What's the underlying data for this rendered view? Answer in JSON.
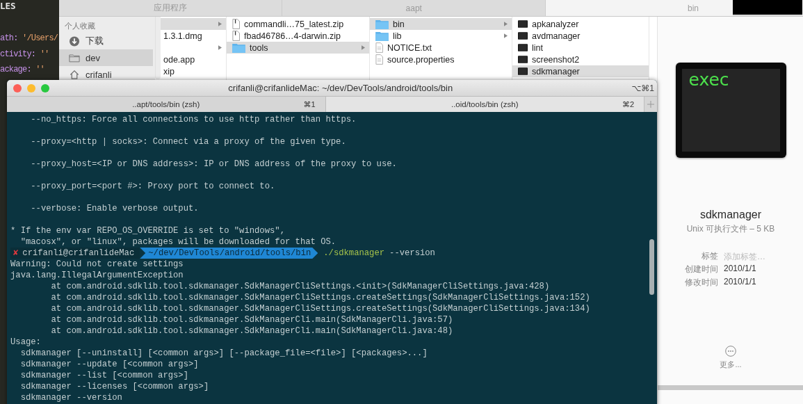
{
  "editor": {
    "heading": "LES",
    "lines": [
      {
        "key": "ath: ",
        "value": "'/Users/"
      },
      {
        "key": "ctivity: ",
        "value": "''"
      },
      {
        "key": "ackage: ",
        "value": "''"
      }
    ]
  },
  "finder": {
    "tabs": [
      {
        "label": "应用程序",
        "selected": false
      },
      {
        "label": "aapt",
        "selected": false
      },
      {
        "label": "bin",
        "selected": true
      }
    ],
    "sidebar": {
      "heading": "个人收藏",
      "items": [
        {
          "label": "下载",
          "kind": "download",
          "selected": false
        },
        {
          "label": "dev",
          "kind": "folder",
          "selected": true
        },
        {
          "label": "crifanli",
          "kind": "home",
          "selected": false
        }
      ]
    },
    "columns": [
      {
        "items": [
          {
            "kind": "none",
            "selected": true,
            "has_children": true
          },
          {
            "label": "1.3.1.dmg",
            "kind": "none",
            "selected": false,
            "has_children": false
          },
          {
            "kind": "none",
            "selected": false,
            "has_children": true
          },
          {
            "label": "ode.app",
            "kind": "none",
            "selected": false,
            "has_children": false
          },
          {
            "label": "xip",
            "kind": "none",
            "selected": false,
            "has_children": false
          }
        ]
      },
      {
        "items": [
          {
            "label": "commandli…75_latest.zip",
            "kind": "zip",
            "selected": false,
            "has_children": false
          },
          {
            "label": "fbad46786…4-darwin.zip",
            "kind": "zip",
            "selected": false,
            "has_children": false
          },
          {
            "label": "tools",
            "kind": "folder",
            "selected": true,
            "has_children": true
          }
        ]
      },
      {
        "items": [
          {
            "label": "bin",
            "kind": "folder",
            "selected": true,
            "has_children": true
          },
          {
            "label": "lib",
            "kind": "folder",
            "selected": false,
            "has_children": true
          },
          {
            "label": "NOTICE.txt",
            "kind": "document",
            "selected": false,
            "has_children": false
          },
          {
            "label": "source.properties",
            "kind": "document",
            "selected": false,
            "has_children": false
          }
        ]
      },
      {
        "items": [
          {
            "label": "apkanalyzer",
            "kind": "exec",
            "selected": false,
            "has_children": false
          },
          {
            "label": "avdmanager",
            "kind": "exec",
            "selected": false,
            "has_children": false
          },
          {
            "label": "lint",
            "kind": "exec",
            "selected": false,
            "has_children": false
          },
          {
            "label": "screenshot2",
            "kind": "exec",
            "selected": false,
            "has_children": false
          },
          {
            "label": "sdkmanager",
            "kind": "exec",
            "selected": true,
            "has_children": false
          }
        ]
      }
    ],
    "preview": {
      "icon_text": "exec",
      "name": "sdkmanager",
      "subtitle": "Unix 可执行文件 – 5 KB",
      "fields": [
        {
          "label": "标签",
          "placeholder": "添加标签…"
        },
        {
          "label": "创建时间",
          "value": "2010/1/1"
        },
        {
          "label": "修改时间",
          "value": "2010/1/1"
        }
      ],
      "more": "更多..."
    }
  },
  "terminal": {
    "title": "crifanli@crifanlideMac: ~/dev/DevTools/android/tools/bin",
    "shortcut": "⌥⌘1",
    "tabs": [
      {
        "label": "..apt/tools/bin (zsh)",
        "shortcut": "⌘1",
        "selected": false
      },
      {
        "label": "..oid/tools/bin (zsh)",
        "shortcut": "⌘2",
        "selected": true
      }
    ],
    "lines": [
      {
        "kind": "text",
        "text": "    --no_https: Force all connections to use http rather than https."
      },
      {
        "kind": "blank"
      },
      {
        "kind": "text",
        "text": "    --proxy=<http | socks>: Connect via a proxy of the given type."
      },
      {
        "kind": "blank"
      },
      {
        "kind": "text",
        "text": "    --proxy_host=<IP or DNS address>: IP or DNS address of the proxy to use."
      },
      {
        "kind": "blank"
      },
      {
        "kind": "text",
        "text": "    --proxy_port=<port #>: Proxy port to connect to."
      },
      {
        "kind": "blank"
      },
      {
        "kind": "text",
        "text": "    --verbose: Enable verbose output."
      },
      {
        "kind": "blank"
      },
      {
        "kind": "text",
        "text": "* If the env var REPO_OS_OVERRIDE is set to \"windows\","
      },
      {
        "kind": "text",
        "text": "  \"macosx\", or \"linux\", packages will be downloaded for that OS."
      },
      {
        "kind": "prompt",
        "status": "✘",
        "user": "crifanli@crifanlideMac",
        "path": "~/dev/DevTools/android/tools/bin",
        "command": "./sdkmanager",
        "args": "--version"
      },
      {
        "kind": "text",
        "text": "Warning: Could not create settings"
      },
      {
        "kind": "text",
        "text": "java.lang.IllegalArgumentException"
      },
      {
        "kind": "text",
        "text": "        at com.android.sdklib.tool.sdkmanager.SdkManagerCliSettings.<init>(SdkManagerCliSettings.java:428)"
      },
      {
        "kind": "text",
        "text": "        at com.android.sdklib.tool.sdkmanager.SdkManagerCliSettings.createSettings(SdkManagerCliSettings.java:152)"
      },
      {
        "kind": "text",
        "text": "        at com.android.sdklib.tool.sdkmanager.SdkManagerCliSettings.createSettings(SdkManagerCliSettings.java:134)"
      },
      {
        "kind": "text",
        "text": "        at com.android.sdklib.tool.sdkmanager.SdkManagerCli.main(SdkManagerCli.java:57)"
      },
      {
        "kind": "text",
        "text": "        at com.android.sdklib.tool.sdkmanager.SdkManagerCli.main(SdkManagerCli.java:48)"
      },
      {
        "kind": "text",
        "text": "Usage:"
      },
      {
        "kind": "text",
        "text": "  sdkmanager [--uninstall] [<common args>] [--package_file=<file>] [<packages>...]"
      },
      {
        "kind": "text",
        "text": "  sdkmanager --update [<common args>]"
      },
      {
        "kind": "text",
        "text": "  sdkmanager --list [<common args>]"
      },
      {
        "kind": "text",
        "text": "  sdkmanager --licenses [<common args>]"
      },
      {
        "kind": "text",
        "text": "  sdkmanager --version"
      }
    ]
  }
}
